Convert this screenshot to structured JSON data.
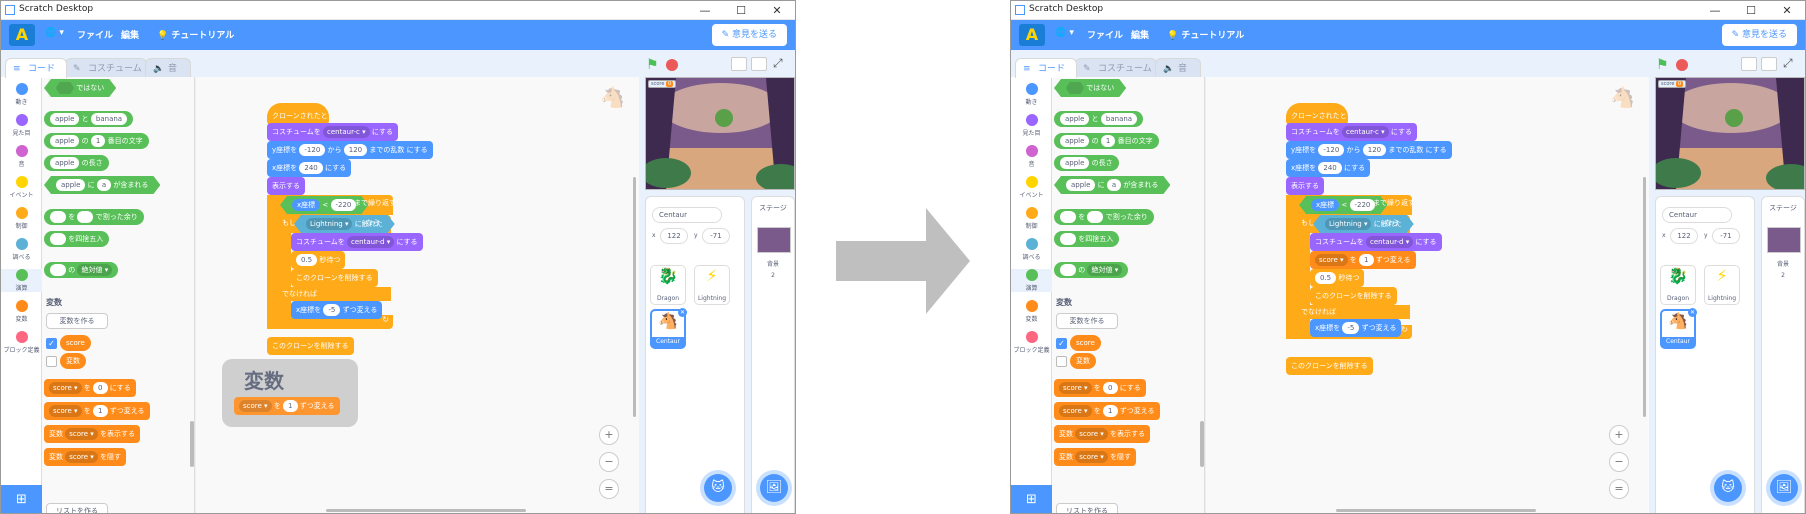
{
  "window": {
    "title": "Scratch Desktop",
    "min": "—",
    "max": "☐",
    "close": "✕"
  },
  "menu": {
    "logo": "A",
    "globe": "🌐 ▾",
    "file": "ファイル",
    "edit": "編集",
    "tutorials": "チュートリアル",
    "feedback": "意見を送る"
  },
  "tabs": {
    "code": "コード",
    "costumes": "コスチューム",
    "sounds": "音"
  },
  "categories": [
    {
      "label": "動き",
      "color": "#4c97ff"
    },
    {
      "label": "見た目",
      "color": "#9966ff"
    },
    {
      "label": "音",
      "color": "#cf63cf"
    },
    {
      "label": "イベント",
      "color": "#ffd500"
    },
    {
      "label": "制御",
      "color": "#ffab19"
    },
    {
      "label": "調べる",
      "color": "#5cb1d6"
    },
    {
      "label": "演算",
      "color": "#59c059"
    },
    {
      "label": "変数",
      "color": "#ff8c1a"
    },
    {
      "label": "ブロック定義",
      "color": "#ff6680"
    }
  ],
  "flyout": {
    "not": "ではない",
    "join_a": "apple",
    "join_mid": "と",
    "join_b": "banana",
    "letter_a": "apple",
    "letter_mid": "の",
    "letter_n": "1",
    "letter_end": "番目の文字",
    "len_a": "apple",
    "len_end": "の長さ",
    "contains_a": "apple",
    "contains_mid": "に",
    "contains_b": "a",
    "contains_end": "が含まれる",
    "mod_mid": "を",
    "mod_end": "で割った余り",
    "round_end": "を四捨五入",
    "abs_mid": "の",
    "abs_op": "絶対値 ▾",
    "var_header": "変数",
    "make_var": "変数を作る",
    "var_score": "score",
    "var_hensu": "変数",
    "set_var": "score ▾",
    "set_mid": "を",
    "set_val": "0",
    "set_end": "にする",
    "chg_var": "score ▾",
    "chg_mid": "を",
    "chg_val": "1",
    "chg_end": "ずつ変える",
    "show_pre": "変数",
    "show_var": "score ▾",
    "show_end": "を表示する",
    "hide_pre": "変数",
    "hide_var": "score ▾",
    "hide_end": "を隠す",
    "make_list": "リストを作る"
  },
  "script": {
    "hat": "クローンされたとき",
    "costume1_pre": "コスチュームを",
    "costume1_val": "centaur-c ▾",
    "costume1_end": "にする",
    "y_pre": "y座標を",
    "y_from": "-120",
    "y_mid": "から",
    "y_to": "120",
    "y_end": "までの乱数",
    "y_end2": "にする",
    "x_pre": "x座標を",
    "x_val": "240",
    "x_end": "にする",
    "show": "表示する",
    "repeat_pre": "x座標",
    "repeat_op": "<",
    "repeat_val": "-220",
    "repeat_end": "まで繰り返す",
    "if_pre": "もし",
    "if_val": "Lightning ▾",
    "if_mid": "に触れた",
    "if_end": "なら",
    "costume2_pre": "コスチュームを",
    "costume2_val": "centaur-d ▾",
    "costume2_end": "にする",
    "wait_val": "0.5",
    "wait_end": "秒待つ",
    "delete1": "このクローンを削除する",
    "else": "でなければ",
    "chgx_pre": "x座標を",
    "chgx_val": "-5",
    "chgx_end": "ずつ変える",
    "delete2": "このクローンを削除する"
  },
  "drag": {
    "title": "変数",
    "var": "score ▾",
    "mid": "を",
    "val": "1",
    "end": "ずつ変える"
  },
  "zoom": {
    "in": "+",
    "out": "−",
    "reset": "="
  },
  "stage": {
    "score_label": "score",
    "score_val": "0"
  },
  "sprite_info": {
    "name": "Centaur",
    "x_label": "x",
    "x_val": "122",
    "y_label": "y",
    "y_val": "-71"
  },
  "sprites": [
    {
      "name": "Dragon"
    },
    {
      "name": "Lightning"
    },
    {
      "name": "Centaur"
    }
  ],
  "stage_panel": {
    "title": "ステージ",
    "backdrop_label": "背景",
    "backdrop_count": "2"
  }
}
